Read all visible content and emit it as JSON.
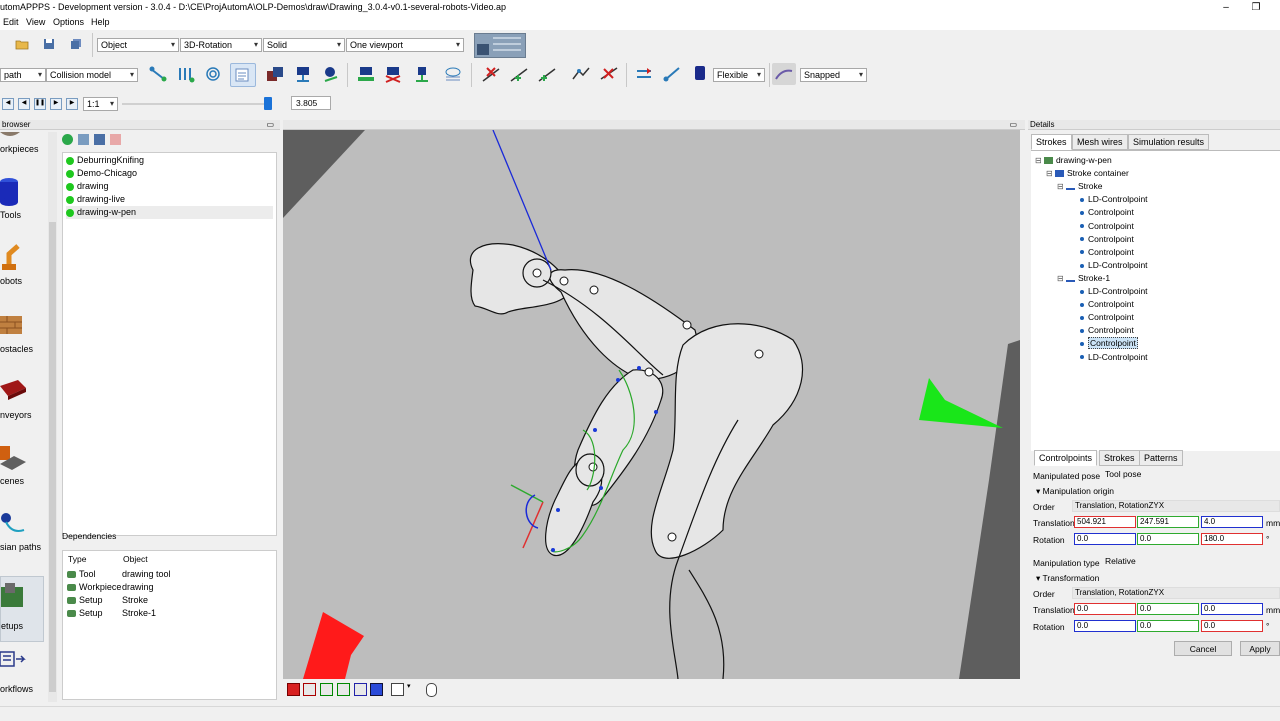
{
  "window": {
    "title": "utomAPPPS - Development version - 3.0.4 - D:\\CE\\ProjAutomA\\OLP-Demos\\draw\\Drawing_3.0.4-v0.1-several-robots-Video.ap",
    "minimize_glyph": "–",
    "restore_glyph": "❐"
  },
  "menu": [
    "Edit",
    "View",
    "Options",
    "Help"
  ],
  "toolbar1": {
    "combos": [
      "Object",
      "3D-Rotation",
      "Solid",
      "One viewport"
    ]
  },
  "toolbar2": {
    "path_combo": "path",
    "collision_combo": "Collision model",
    "flexible_combo": "Flexible",
    "snapped_combo": "Snapped"
  },
  "toolbar3": {
    "speed_combo": "1:1",
    "time_value": "3.805"
  },
  "left_panel": {
    "header": "browser",
    "categories": [
      "orkpieces",
      "Tools",
      "obots",
      "ostacles",
      "nveyors",
      "cenes",
      "sian paths",
      "etups",
      "orkflows"
    ]
  },
  "setups_list": {
    "items": [
      "DeburringKnifing",
      "Demo-Chicago",
      "drawing",
      "drawing-live",
      "drawing-w-pen"
    ],
    "selected_index": 4
  },
  "dependencies": {
    "title": "Dependencies",
    "headers": [
      "Type",
      "Object"
    ],
    "rows": [
      {
        "type": "Tool",
        "object": "drawing tool"
      },
      {
        "type": "Workpiece",
        "object": "drawing"
      },
      {
        "type": "Setup",
        "object": "Stroke"
      },
      {
        "type": "Setup",
        "object": "Stroke-1"
      }
    ]
  },
  "details": {
    "header": "Details",
    "tabs": [
      "Strokes",
      "Mesh wires",
      "Simulation results"
    ],
    "tree": [
      {
        "label": "drawing-w-pen",
        "level": 0,
        "kind": "root"
      },
      {
        "label": "Stroke container",
        "level": 1,
        "kind": "container"
      },
      {
        "label": "Stroke",
        "level": 2,
        "kind": "stroke"
      },
      {
        "label": "LD-Controlpoint",
        "level": 3,
        "kind": "point"
      },
      {
        "label": "Controlpoint",
        "level": 3,
        "kind": "point"
      },
      {
        "label": "Controlpoint",
        "level": 3,
        "kind": "point"
      },
      {
        "label": "Controlpoint",
        "level": 3,
        "kind": "point"
      },
      {
        "label": "Controlpoint",
        "level": 3,
        "kind": "point"
      },
      {
        "label": "LD-Controlpoint",
        "level": 3,
        "kind": "point"
      },
      {
        "label": "Stroke-1",
        "level": 2,
        "kind": "stroke"
      },
      {
        "label": "LD-Controlpoint",
        "level": 3,
        "kind": "point"
      },
      {
        "label": "Controlpoint",
        "level": 3,
        "kind": "point"
      },
      {
        "label": "Controlpoint",
        "level": 3,
        "kind": "point"
      },
      {
        "label": "Controlpoint",
        "level": 3,
        "kind": "point"
      },
      {
        "label": "Controlpoint",
        "level": 3,
        "kind": "point",
        "selected": true
      },
      {
        "label": "LD-Controlpoint",
        "level": 3,
        "kind": "point"
      }
    ],
    "sub_tabs": [
      "Controlpoints",
      "Strokes",
      "Patterns"
    ],
    "manipulated_pose_label": "Manipulated pose",
    "manipulated_pose_value": "Tool pose",
    "origin_group": "Manipulation origin",
    "order_label": "Order",
    "order_value": "Translation, RotationZYX",
    "translation_label": "Translation",
    "translation": [
      "504.921",
      "247.591",
      "4.0"
    ],
    "rotation_label": "Rotation",
    "rotation": [
      "0.0",
      "0.0",
      "180.0"
    ],
    "unit_mm": "mm",
    "unit_deg": "°",
    "manip_type_label": "Manipulation type",
    "manip_type_value": "Relative",
    "transform_group": "Transformation",
    "t_order_label": "Order",
    "t_order_value": "Translation, RotationZYX",
    "t_translation_label": "Translation",
    "t_translation": [
      "0.0",
      "0.0",
      "0.0"
    ],
    "t_rotation_label": "Rotation",
    "t_rotation": [
      "0.0",
      "0.0",
      "0.0"
    ],
    "cancel": "Cancel",
    "apply": "Apply"
  },
  "colors": {
    "accent_green": "#1ec81e",
    "select_bg": "#cce4f7",
    "x_axis": "#e03030",
    "y_axis": "#2eaa2e",
    "z_axis": "#2030d0"
  }
}
